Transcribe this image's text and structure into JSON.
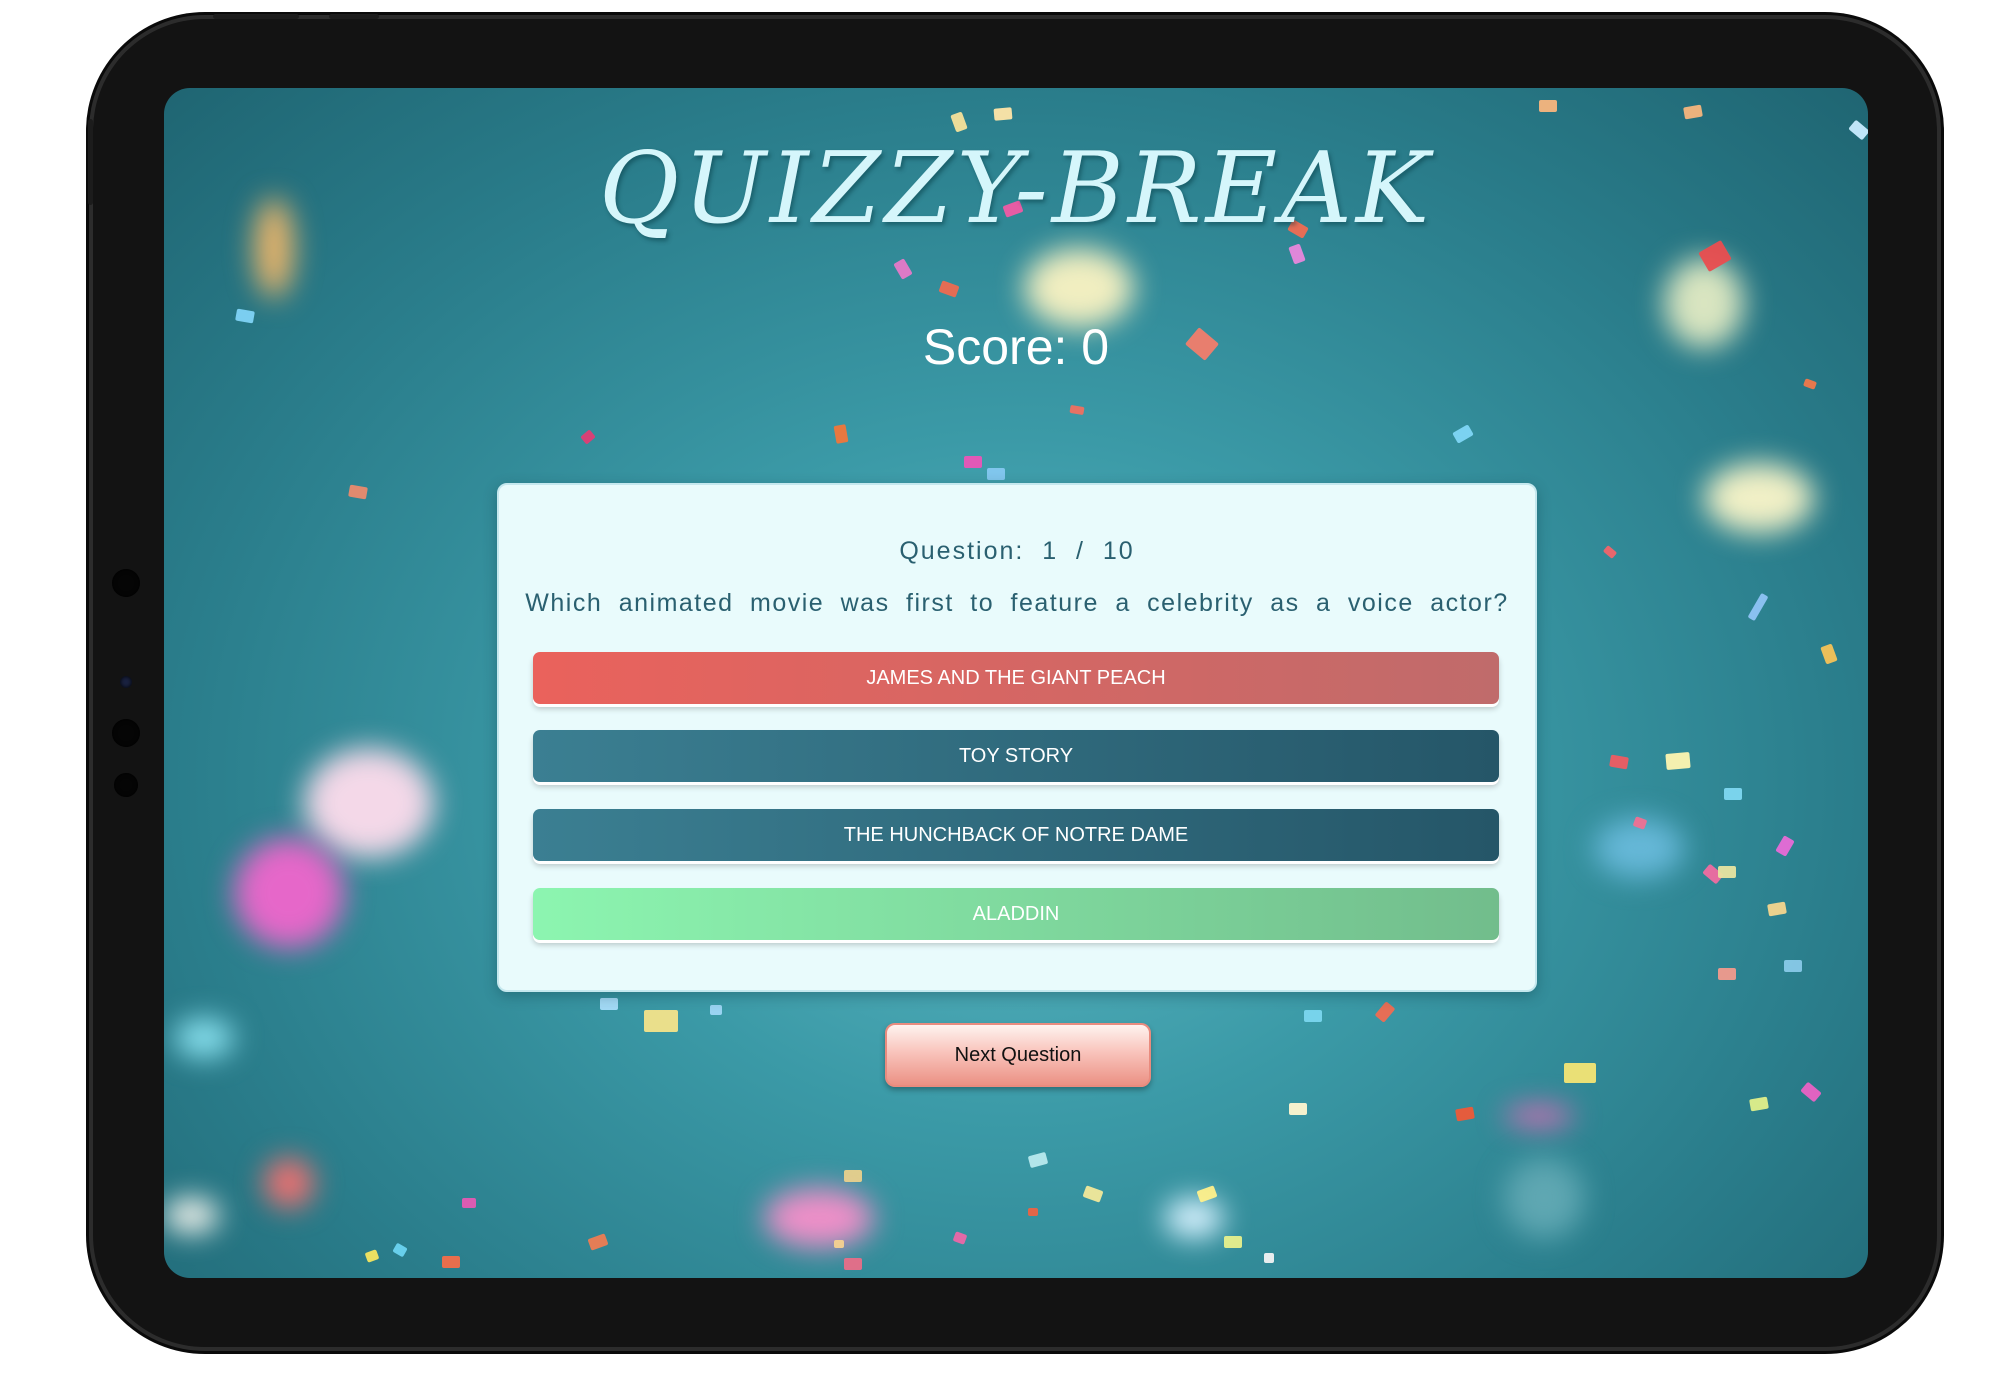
{
  "app": {
    "title": "QUIZZY-BREAK",
    "score_text": "Score: 0"
  },
  "quiz": {
    "question_counter": "Question:  1  /  10",
    "question_text": "Which animated movie was first to feature a celebrity as a voice actor?",
    "answers": [
      {
        "label": "JAMES AND THE GIANT PEACH",
        "state": "incorrect"
      },
      {
        "label": "TOY STORY",
        "state": "neutral"
      },
      {
        "label": "THE HUNCHBACK OF NOTRE DAME",
        "state": "neutral"
      },
      {
        "label": "ALADDIN",
        "state": "correct"
      }
    ],
    "next_label": "Next Question"
  },
  "colors": {
    "incorrect": "#ea625c",
    "neutral": "#2f6d80",
    "correct": "#8cf5b0",
    "title": "#d5f6fb",
    "background": "#3b9aa7"
  }
}
